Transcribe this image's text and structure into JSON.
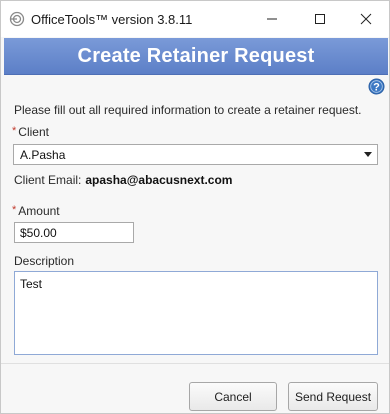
{
  "window": {
    "title": "OfficeTools™ version 3.8.11",
    "icon": "officetools-logo-icon",
    "controls": [
      "minimize-icon",
      "maximize-icon",
      "close-icon"
    ]
  },
  "header": {
    "title": "Create Retainer Request",
    "help_icon": "help-icon"
  },
  "form": {
    "instructions": "Please fill out all required information to create a retainer request.",
    "client": {
      "required_mark": "*",
      "label": "Client",
      "selected_value": "A.Pasha"
    },
    "client_email": {
      "label": "Client Email:",
      "value": "apasha@abacusnext.com"
    },
    "amount": {
      "required_mark": "*",
      "label": "Amount",
      "value": "$50.00"
    },
    "description": {
      "label": "Description",
      "value": "Test"
    }
  },
  "buttons": {
    "cancel": "Cancel",
    "send": "Send Request"
  },
  "colors": {
    "header_band": "#6b8dd0",
    "required_mark": "#c0392b",
    "help_icon": "#3b78c4"
  }
}
